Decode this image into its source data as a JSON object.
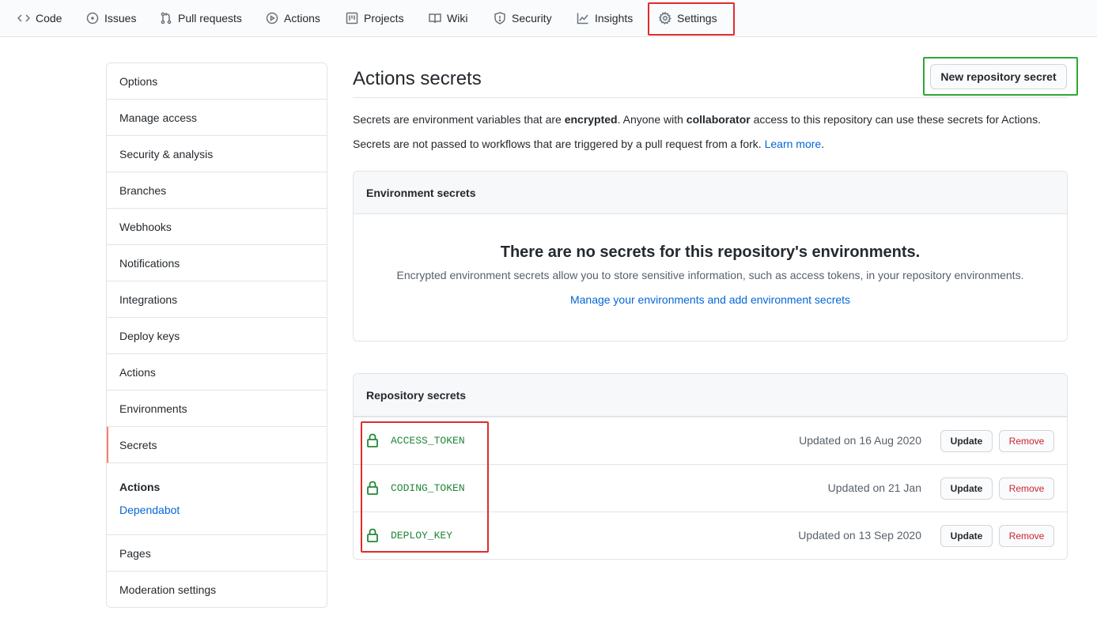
{
  "nav": {
    "tabs": [
      {
        "label": "Code",
        "icon": "code-icon"
      },
      {
        "label": "Issues",
        "icon": "issue-opened-icon"
      },
      {
        "label": "Pull requests",
        "icon": "git-pull-request-icon"
      },
      {
        "label": "Actions",
        "icon": "play-icon"
      },
      {
        "label": "Projects",
        "icon": "project-icon"
      },
      {
        "label": "Wiki",
        "icon": "book-icon"
      },
      {
        "label": "Security",
        "icon": "shield-icon"
      },
      {
        "label": "Insights",
        "icon": "graph-icon"
      },
      {
        "label": "Settings",
        "icon": "gear-icon"
      }
    ],
    "selected": "Settings"
  },
  "sidebar": {
    "items": [
      {
        "label": "Options"
      },
      {
        "label": "Manage access"
      },
      {
        "label": "Security & analysis"
      },
      {
        "label": "Branches"
      },
      {
        "label": "Webhooks"
      },
      {
        "label": "Notifications"
      },
      {
        "label": "Integrations"
      },
      {
        "label": "Deploy keys"
      },
      {
        "label": "Actions"
      },
      {
        "label": "Environments"
      },
      {
        "label": "Secrets"
      }
    ],
    "selected": "Secrets",
    "group": {
      "title": "Actions",
      "link": "Dependabot"
    },
    "bottom_items": [
      {
        "label": "Pages"
      },
      {
        "label": "Moderation settings"
      }
    ]
  },
  "main": {
    "title": "Actions secrets",
    "new_button": "New repository secret",
    "desc1": {
      "p1": "Secrets are environment variables that are ",
      "b1": "encrypted",
      "p2": ". Anyone with ",
      "b2": "collaborator",
      "p3": " access to this repository can use these secrets for Actions."
    },
    "desc2": {
      "text": "Secrets are not passed to workflows that are triggered by a pull request from a fork. ",
      "link": "Learn more",
      "end": "."
    },
    "env": {
      "header": "Environment secrets",
      "blank_title": "There are no secrets for this repository's environments.",
      "blank_desc": "Encrypted environment secrets allow you to store sensitive information, such as access tokens, in your repository environments.",
      "blank_link": "Manage your environments and add environment secrets"
    },
    "repo": {
      "header": "Repository secrets",
      "update_label": "Update",
      "remove_label": "Remove",
      "secrets": [
        {
          "name": "ACCESS_TOKEN",
          "updated": "Updated on 16 Aug 2020"
        },
        {
          "name": "CODING_TOKEN",
          "updated": "Updated on 21 Jan"
        },
        {
          "name": "DEPLOY_KEY",
          "updated": "Updated on 13 Sep 2020"
        }
      ]
    }
  },
  "colors": {
    "highlight_red": "#e02b2b",
    "highlight_green": "#2ea836",
    "secret_green": "#22863a",
    "link_blue": "#0366d6",
    "selected_accent": "#f9826c",
    "remove_red": "#cb2431"
  }
}
